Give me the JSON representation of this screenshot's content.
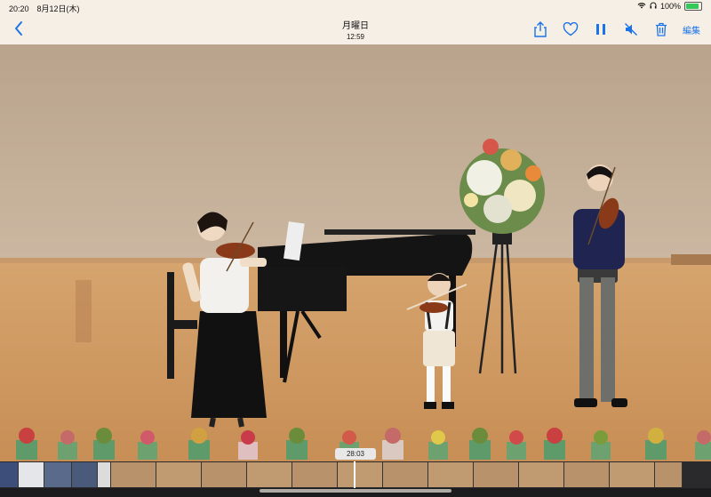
{
  "status_bar": {
    "time_date": "20:20　8月12日(木)",
    "battery": "100%",
    "battery_level": 1.0
  },
  "nav": {
    "title": "月曜日",
    "subtitle": "12:59",
    "edit_label": "編集",
    "icons": [
      "chevron-left-icon",
      "share-icon",
      "heart-icon",
      "pause-icon",
      "mute-icon",
      "trash-icon"
    ],
    "accent_color": "#1a73e8"
  },
  "scrubber": {
    "time": "28:03"
  }
}
